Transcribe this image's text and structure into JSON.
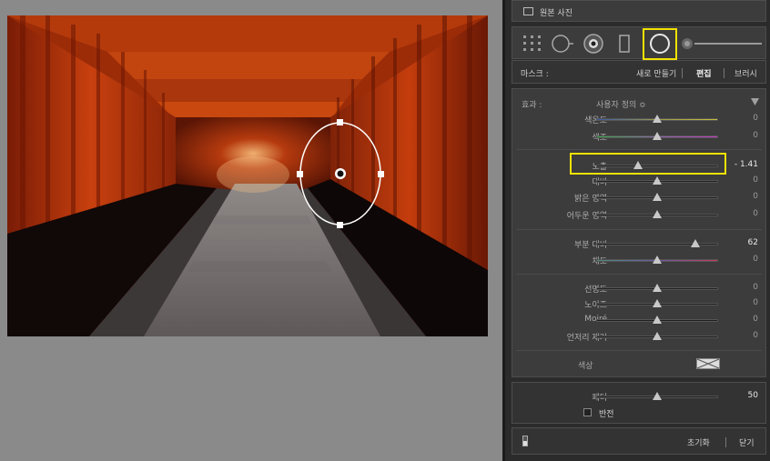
{
  "panel": {
    "original_photo": "원본 사진",
    "mask": {
      "label": "마스크 :",
      "new": "새로 만들기",
      "edit": "편집",
      "brush": "브러시"
    },
    "effect": {
      "label": "효과 :",
      "preset": "사용자 정의 ≎"
    },
    "sliders": [
      {
        "label": "색온도",
        "value": "0",
        "pos": 0.5
      },
      {
        "label": "색조",
        "value": "0",
        "pos": 0.5
      },
      {
        "label": "노출",
        "value": "- 1.41",
        "pos": 0.34
      },
      {
        "label": "대비",
        "value": "0",
        "pos": 0.5
      },
      {
        "label": "밝은 영역",
        "value": "0",
        "pos": 0.5
      },
      {
        "label": "어두운 영역",
        "value": "0",
        "pos": 0.5
      },
      {
        "label": "부분 대비",
        "value": "62",
        "pos": 0.81
      },
      {
        "label": "채도",
        "value": "0",
        "pos": 0.5
      },
      {
        "label": "선명도",
        "value": "0",
        "pos": 0.5
      },
      {
        "label": "노이즈",
        "value": "0",
        "pos": 0.5
      },
      {
        "label": "Moiré",
        "value": "0",
        "pos": 0.5
      },
      {
        "label": "언저리 제거",
        "value": "0",
        "pos": 0.5
      }
    ],
    "color_label": "색상",
    "feather": {
      "label": "페더",
      "value": "50",
      "pos": 0.5
    },
    "invert_label": "반전",
    "reset": "초기화",
    "close": "닫기"
  },
  "colors": {
    "highlight": "#f2e200",
    "torii_orange": "#d8430c"
  }
}
